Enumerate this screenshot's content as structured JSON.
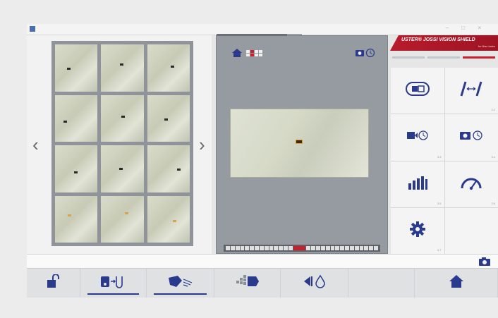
{
  "window": {
    "controls": "–  □  ×"
  },
  "left_panel": {
    "prev_glyph": "‹",
    "next_glyph": "›",
    "thumbnails": [
      {
        "mark": "dark-spot"
      },
      {
        "mark": "dark-spot"
      },
      {
        "mark": "dark-spot"
      },
      {
        "mark": "dark-spot"
      },
      {
        "mark": "dark-spot"
      },
      {
        "mark": "dark-spot"
      },
      {
        "mark": "dark-spot"
      },
      {
        "mark": "dark-spot"
      },
      {
        "mark": "dark-spot"
      },
      {
        "mark": "light"
      },
      {
        "mark": "light"
      },
      {
        "mark": "light"
      }
    ]
  },
  "brand": {
    "title": "USTER® JOSSI VISION SHIELD",
    "subtitle": "for fiber bales",
    "color": "#b71c2c"
  },
  "tiles": [
    {
      "icon": "vision-shield-icon",
      "code": ""
    },
    {
      "icon": "calibration-icon",
      "code": "3.2"
    },
    {
      "icon": "video-timer-icon",
      "code": "3.3"
    },
    {
      "icon": "camera-timer-icon",
      "code": "3.4"
    },
    {
      "icon": "statistics-icon",
      "code": "3.5"
    },
    {
      "icon": "performance-gauge-icon",
      "code": "3.6"
    },
    {
      "icon": "settings-gear-icon",
      "code": "3.7"
    },
    {
      "icon": "",
      "code": ""
    }
  ],
  "toolbar": [
    {
      "icon": "unlock-icon",
      "active": false
    },
    {
      "icon": "camera-switch-icon",
      "active": true
    },
    {
      "icon": "hand-scan-icon",
      "active": true
    },
    {
      "icon": "fiber-matrix-icon",
      "active": false
    },
    {
      "icon": "eject-drop-icon",
      "active": false
    },
    {
      "icon": "",
      "active": false
    },
    {
      "icon": "home-icon",
      "active": false
    }
  ],
  "colors": {
    "accent_red": "#c8202f",
    "icon_blue": "#2a3a8c",
    "panel_grey": "#969ba2"
  }
}
